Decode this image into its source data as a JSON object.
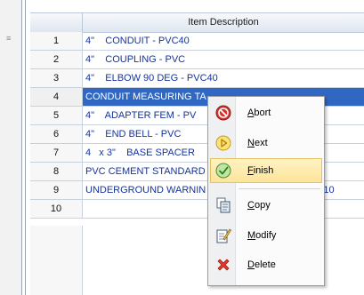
{
  "grid": {
    "header": "Item Description",
    "rows": [
      {
        "num": "1",
        "desc": "4\"    CONDUIT - PVC40"
      },
      {
        "num": "2",
        "desc": "4\"    COUPLING - PVC"
      },
      {
        "num": "3",
        "desc": "4\"    ELBOW 90 DEG - PVC40"
      },
      {
        "num": "4",
        "desc": "CONDUIT MEASURING TA"
      },
      {
        "num": "5",
        "desc": "4\"    ADAPTER FEM - PV"
      },
      {
        "num": "6",
        "desc": "4\"    END BELL - PVC"
      },
      {
        "num": "7",
        "desc": "4   x 3\"    BASE SPACER"
      },
      {
        "num": "8",
        "desc": "PVC CEMENT STANDARD"
      },
      {
        "num": "9",
        "desc": "UNDERGROUND WARNIN"
      },
      {
        "num": "10",
        "desc": ""
      }
    ],
    "row9_tail": "- PER 10"
  },
  "context_menu": {
    "items": [
      {
        "key": "abort",
        "first": "A",
        "rest": "bort",
        "icon": "abort-icon"
      },
      {
        "key": "next",
        "first": "N",
        "rest": "ext",
        "icon": "next-icon"
      },
      {
        "key": "finish",
        "first": "F",
        "rest": "inish",
        "icon": "finish-icon"
      },
      {
        "key": "copy",
        "first": "C",
        "rest": "opy",
        "icon": "copy-icon"
      },
      {
        "key": "modify",
        "first": "M",
        "rest": "odify",
        "icon": "modify-icon"
      },
      {
        "key": "delete",
        "first": "D",
        "rest": "elete",
        "icon": "delete-icon"
      }
    ]
  },
  "colors": {
    "selection": "#3067c2",
    "link_text": "#16349c",
    "hover": "#fde49a"
  }
}
